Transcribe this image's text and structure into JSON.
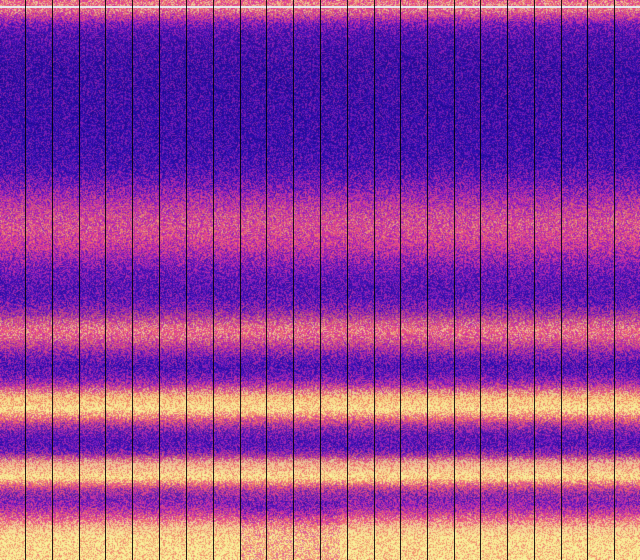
{
  "palette": {
    "low": "#1e0a8c",
    "deep": "#2a0fb4",
    "mid": "#8a1fbf",
    "hot": "#e0389a",
    "warm": "#f07a5a",
    "high": "#f8f29a",
    "divider": "#000000",
    "top_line": "#e8e6f0"
  },
  "image": {
    "description_type": "spectrogram-like noise field with horizontal bands"
  }
}
